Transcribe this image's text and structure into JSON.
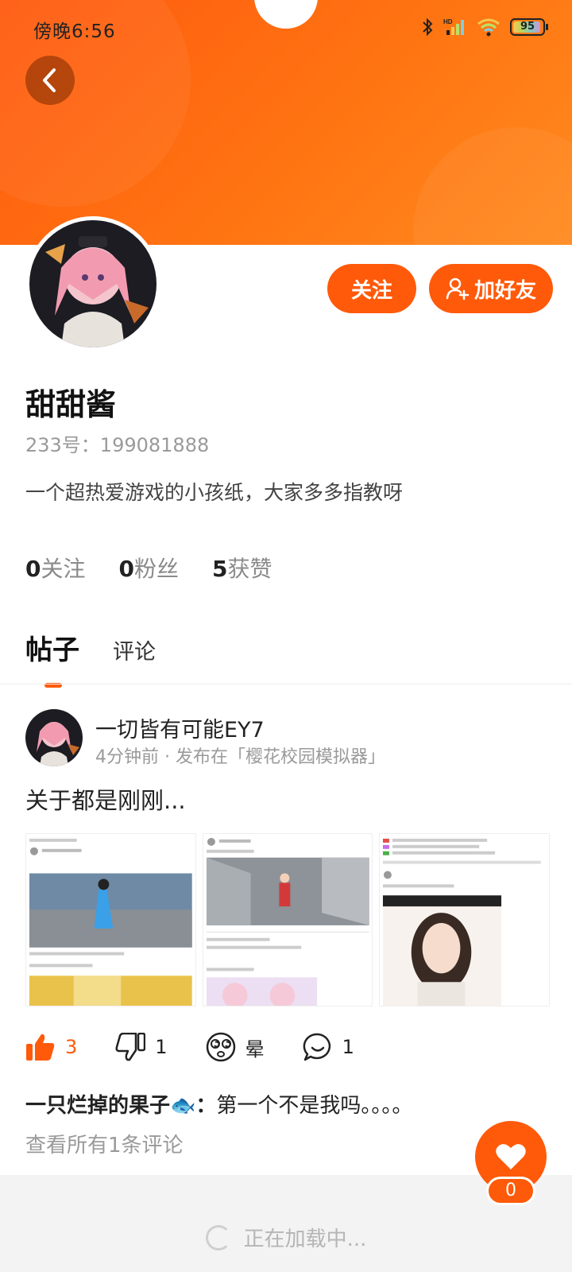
{
  "status_bar": {
    "time": "傍晚6:56",
    "battery": "95"
  },
  "profile": {
    "name": "甜甜酱",
    "id_label": "233号：199081888",
    "bio": "一个超热爱游戏的小孩纸，大家多多指教呀",
    "follow_label": "关注",
    "add_friend_label": "加好友",
    "stats": [
      {
        "count": "0",
        "label": "关注"
      },
      {
        "count": "0",
        "label": "粉丝"
      },
      {
        "count": "5",
        "label": "获赞"
      }
    ]
  },
  "tabs": {
    "active": "帖子",
    "other": "评论"
  },
  "post": {
    "author": "一切皆有可能EY7",
    "meta": "4分钟前 · 发布在「樱花校园模拟器」",
    "title": "关于都是刚刚...",
    "actions": {
      "likes": "3",
      "dislikes": "1",
      "dizzy": "晕",
      "comments": "1"
    },
    "comment": {
      "user": "一只烂掉的果子🐟：",
      "text": "第一个不是我吗。。。。"
    },
    "view_all": "查看所有1条评论"
  },
  "fab": {
    "count": "0"
  },
  "footer": {
    "loading_text": "正在加载中..."
  },
  "colors": {
    "accent": "#ff5a0a",
    "banner_start": "#ff5a0f",
    "banner_end": "#ff8a1f"
  }
}
